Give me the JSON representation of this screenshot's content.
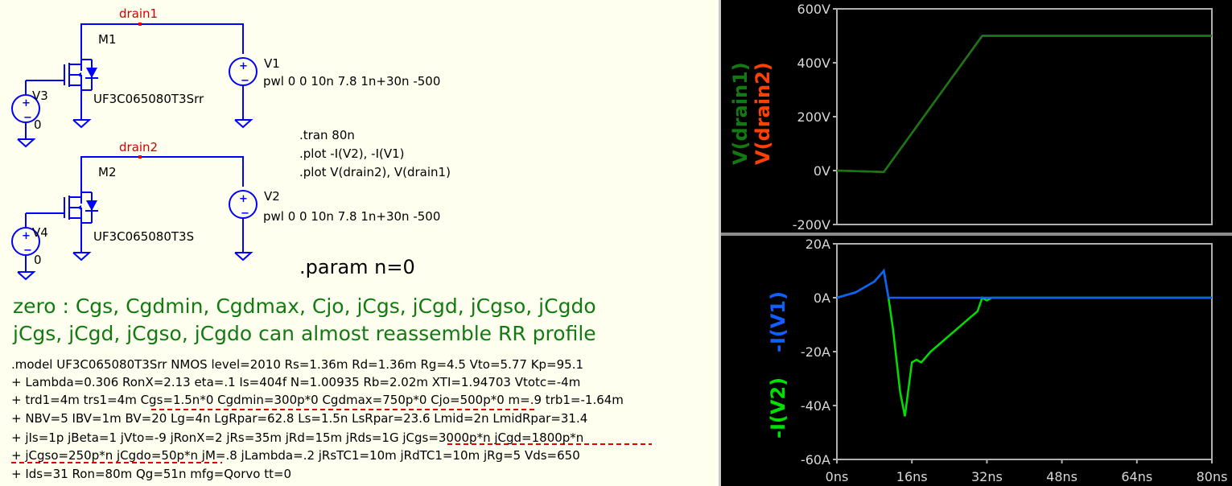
{
  "schematic": {
    "net_labels": {
      "drain1": "drain1",
      "drain2": "drain2"
    },
    "components": {
      "m1": {
        "name": "M1",
        "model": "UF3C065080T3Srr"
      },
      "m2": {
        "name": "M2",
        "model": "UF3C065080T3S"
      },
      "v1": {
        "name": "V1",
        "value": "pwl 0 0 10n 7.8 1n+30n -500"
      },
      "v2": {
        "name": "V2",
        "value": "pwl 0 0 10n 7.8 1n+30n -500"
      },
      "v3": {
        "name": "V3",
        "value": "0"
      },
      "v4": {
        "name": "V4",
        "value": "0"
      }
    },
    "directives": [
      ".tran 80n",
      ".plot -I(V2), -I(V1)",
      ".plot V(drain2), V(drain1)"
    ],
    "param": ".param n=0",
    "comments": [
      "zero : Cgs, Cgdmin, Cgdmax, Cjo, jCgs, jCgd, jCgso, jCgdo",
      "jCgs, jCgd, jCgso, jCgdo can almost reassemble RR profile"
    ],
    "model_lines": [
      ".model UF3C065080T3Srr NMOS level=2010 Rs=1.36m Rd=1.36m Rg=4.5 Vto=5.77 Kp=95.1",
      "+ Lambda=0.306 RonX=2.13 eta=.1 Is=404f N=1.00935 Rb=2.02m XTI=1.94703 Vtotc=-4m",
      "+ trd1=4m trs1=4m Cgs=1.5n*0 Cgdmin=300p*0 Cgdmax=750p*0 Cjo=500p*0 m=.9 trb1=-1.64m",
      "+ NBV=5 IBV=1m BV=20 Lg=4n LgRpar=62.8 Ls=1.5n LsRpar=23.6 Lmid=2n LmidRpar=31.4",
      "+ jIs=1p jBeta=1 jVto=-9 jRonX=2 jRs=35m jRd=15m jRds=1G jCgs=3000p*n jCgd=1800p*n",
      "+ jCgso=250p*n jCgdo=50p*n jM=.8 jLambda=.2 jRsTC1=10m jRdTC1=10m jRg=5 Vds=650",
      "+ Ids=31 Ron=80m Qg=51n mfg=Qorvo tt=0"
    ],
    "colors": {
      "wire": "#0000ff",
      "net_label": "#d00000",
      "comment": "#137a13",
      "underline": "#e00000"
    }
  },
  "plots": {
    "x_tick_labels": [
      "0ns",
      "16ns",
      "32ns",
      "48ns",
      "64ns",
      "80ns"
    ],
    "voltage_pane": {
      "trace_labels": [
        "V(drain1)",
        "V(drain2)"
      ],
      "y_tick_labels": [
        "600V",
        "400V",
        "200V",
        "0V",
        "-200V"
      ],
      "trace_colors": {
        "V(drain1)": "#137a13",
        "V(drain2)": "#ff4000"
      }
    },
    "current_pane": {
      "trace_labels": [
        "-I(V1)",
        "-I(V2)"
      ],
      "y_tick_labels": [
        "20A",
        "0A",
        "-20A",
        "-40A",
        "-60A"
      ],
      "trace_colors": {
        "-I(V1)": "#1060ff",
        "-I(V2)": "#00e000"
      }
    }
  },
  "chart_data": [
    {
      "type": "line",
      "title": "",
      "xlabel": "",
      "ylabel": "",
      "xlim": [
        0,
        80
      ],
      "ylim": [
        -200,
        600
      ],
      "x_unit": "ns",
      "y_unit": "V",
      "series": [
        {
          "name": "V(drain1)",
          "x": [
            0,
            10,
            31,
            80
          ],
          "y": [
            0,
            -5,
            500,
            500
          ]
        },
        {
          "name": "V(drain2)",
          "x": [
            0,
            10,
            31,
            80
          ],
          "y": [
            0,
            -5,
            500,
            500
          ]
        }
      ],
      "grid": false
    },
    {
      "type": "line",
      "title": "",
      "xlabel": "",
      "ylabel": "",
      "xlim": [
        0,
        80
      ],
      "ylim": [
        -60,
        20
      ],
      "x_unit": "ns",
      "y_unit": "A",
      "series": [
        {
          "name": "-I(V1)",
          "x": [
            0,
            4,
            8,
            10,
            11,
            80
          ],
          "y": [
            0,
            2,
            6,
            10,
            0,
            0
          ]
        },
        {
          "name": "-I(V2)",
          "x": [
            0,
            4,
            8,
            10,
            11,
            12,
            13.5,
            14.5,
            16,
            17,
            18,
            20,
            24,
            28,
            30,
            31,
            32,
            33,
            80
          ],
          "y": [
            0,
            2,
            6,
            10,
            0,
            -12,
            -35,
            -44,
            -24,
            -23,
            -24,
            -20,
            -14,
            -8,
            -5,
            0,
            -1,
            0,
            0
          ]
        }
      ],
      "grid": false
    }
  ]
}
